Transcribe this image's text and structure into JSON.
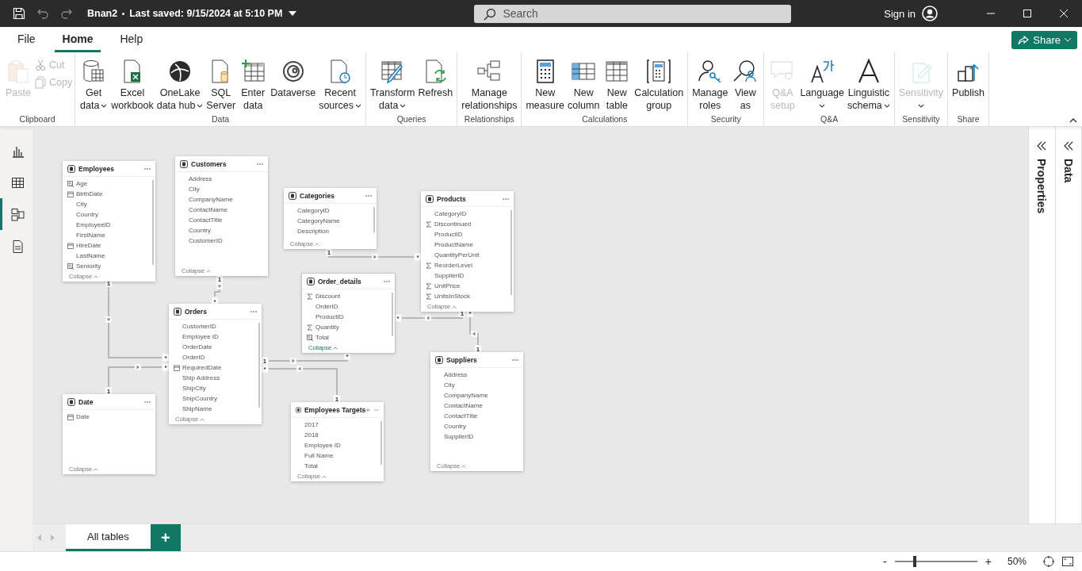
{
  "title_bar": {
    "title": "Bnan2",
    "saved": "Last saved: 9/15/2024 at 5:10 PM",
    "search": {
      "placeholder": "Search"
    },
    "sign_in": "Sign in"
  },
  "menu": [
    {
      "label": "File",
      "selected": false
    },
    {
      "label": "Home",
      "selected": true
    },
    {
      "label": "Help",
      "selected": false
    }
  ],
  "share": "Share",
  "ribbon": [
    {
      "label": "Clipboard",
      "items": [
        {
          "kind": "large",
          "lines": [
            "Paste"
          ],
          "disabled": true,
          "dropdown": false
        },
        {
          "kind": "small",
          "lines": [
            "Cut"
          ],
          "disabled": true
        },
        {
          "kind": "small",
          "lines": [
            "Copy"
          ],
          "disabled": true
        }
      ]
    },
    {
      "label": "Data",
      "items": [
        {
          "kind": "large",
          "lines": [
            "Get",
            "data"
          ],
          "disabled": false,
          "dropdown": true
        },
        {
          "kind": "large",
          "lines": [
            "Excel",
            "workbook"
          ],
          "disabled": false,
          "dropdown": false
        },
        {
          "kind": "large",
          "lines": [
            "OneLake",
            "data hub"
          ],
          "disabled": false,
          "dropdown": true
        },
        {
          "kind": "large",
          "lines": [
            "SQL",
            "Server"
          ],
          "disabled": false,
          "dropdown": false
        },
        {
          "kind": "large",
          "lines": [
            "Enter",
            "data"
          ],
          "disabled": false,
          "dropdown": false
        },
        {
          "kind": "large",
          "lines": [
            "Dataverse"
          ],
          "disabled": false,
          "dropdown": false
        },
        {
          "kind": "large",
          "lines": [
            "Recent",
            "sources"
          ],
          "disabled": false,
          "dropdown": true
        }
      ]
    },
    {
      "label": "Queries",
      "items": [
        {
          "kind": "large",
          "lines": [
            "Transform",
            "data"
          ],
          "disabled": false,
          "dropdown": true
        },
        {
          "kind": "large",
          "lines": [
            "Refresh"
          ],
          "disabled": false,
          "dropdown": false
        }
      ]
    },
    {
      "label": "Relationships",
      "items": [
        {
          "kind": "large",
          "lines": [
            "Manage",
            "relationships"
          ],
          "disabled": false,
          "dropdown": false
        }
      ]
    },
    {
      "label": "Calculations",
      "items": [
        {
          "kind": "large",
          "lines": [
            "New",
            "measure"
          ],
          "disabled": false,
          "dropdown": false
        },
        {
          "kind": "large",
          "lines": [
            "New",
            "column"
          ],
          "disabled": false,
          "dropdown": false
        },
        {
          "kind": "large",
          "lines": [
            "New",
            "table"
          ],
          "disabled": false,
          "dropdown": false
        },
        {
          "kind": "large",
          "lines": [
            "Calculation",
            "group"
          ],
          "disabled": false,
          "dropdown": false
        }
      ]
    },
    {
      "label": "Security",
      "items": [
        {
          "kind": "large",
          "lines": [
            "Manage",
            "roles"
          ],
          "disabled": false,
          "dropdown": false
        },
        {
          "kind": "large",
          "lines": [
            "View",
            "as"
          ],
          "disabled": false,
          "dropdown": false
        }
      ]
    },
    {
      "label": "Q&A",
      "items": [
        {
          "kind": "large",
          "lines": [
            "Q&A",
            "setup"
          ],
          "disabled": true,
          "dropdown": false
        },
        {
          "kind": "large",
          "lines": [
            "Language"
          ],
          "disabled": false,
          "dropdown": true
        },
        {
          "kind": "large",
          "lines": [
            "Linguistic",
            "schema"
          ],
          "disabled": false,
          "dropdown": true
        }
      ]
    },
    {
      "label": "Sensitivity",
      "items": [
        {
          "kind": "large",
          "lines": [
            "Sensitivity"
          ],
          "disabled": true,
          "dropdown": true
        }
      ]
    },
    {
      "label": "Share",
      "items": [
        {
          "kind": "large",
          "lines": [
            "Publish"
          ],
          "disabled": false,
          "dropdown": false
        }
      ]
    }
  ],
  "views": [
    {
      "selected": false
    },
    {
      "selected": false
    },
    {
      "selected": true
    },
    {
      "selected": false
    }
  ],
  "tables": [
    {
      "name": "Employees",
      "eye": false,
      "selected": false,
      "collapse": "Collapse",
      "fields": [
        {
          "name": "Age",
          "kind": "calc"
        },
        {
          "name": "BirthDate",
          "kind": "date"
        },
        {
          "name": "City",
          "kind": "plain"
        },
        {
          "name": "Country",
          "kind": "plain"
        },
        {
          "name": "EmployeeID",
          "kind": "plain"
        },
        {
          "name": "FirstName",
          "kind": "plain"
        },
        {
          "name": "HireDate",
          "kind": "date"
        },
        {
          "name": "LastName",
          "kind": "plain"
        },
        {
          "name": "Seniority",
          "kind": "calc"
        }
      ]
    },
    {
      "name": "Customers",
      "eye": false,
      "selected": false,
      "collapse": "Collapse",
      "fields": [
        {
          "name": "Address",
          "kind": "plain"
        },
        {
          "name": "City",
          "kind": "plain"
        },
        {
          "name": "CompanyName",
          "kind": "plain"
        },
        {
          "name": "ContactName",
          "kind": "plain"
        },
        {
          "name": "ContactTitle",
          "kind": "plain"
        },
        {
          "name": "Country",
          "kind": "plain"
        },
        {
          "name": "CustomerID",
          "kind": "plain"
        }
      ]
    },
    {
      "name": "Categories",
      "eye": false,
      "selected": false,
      "collapse": "Collapse",
      "fields": [
        {
          "name": "CategoryID",
          "kind": "plain"
        },
        {
          "name": "CategoryName",
          "kind": "plain"
        },
        {
          "name": "Description",
          "kind": "plain"
        }
      ]
    },
    {
      "name": "Products",
      "eye": false,
      "selected": false,
      "collapse": "Collapse",
      "fields": [
        {
          "name": "CategoryID",
          "kind": "plain"
        },
        {
          "name": "Discontinued",
          "kind": "sum"
        },
        {
          "name": "ProductID",
          "kind": "plain"
        },
        {
          "name": "ProductName",
          "kind": "plain"
        },
        {
          "name": "QuantityPerUnit",
          "kind": "plain"
        },
        {
          "name": "ReorderLevel",
          "kind": "sum"
        },
        {
          "name": "SupplierID",
          "kind": "plain"
        },
        {
          "name": "UnitPrice",
          "kind": "sum"
        },
        {
          "name": "UnitsInStock",
          "kind": "sum"
        }
      ]
    },
    {
      "name": "Order_details",
      "eye": false,
      "selected": true,
      "collapse": "Collapse",
      "fields": [
        {
          "name": "Discount",
          "kind": "sum"
        },
        {
          "name": "OrderID",
          "kind": "plain"
        },
        {
          "name": "ProductID",
          "kind": "plain"
        },
        {
          "name": "Quantity",
          "kind": "sum"
        },
        {
          "name": "Total",
          "kind": "calc"
        }
      ]
    },
    {
      "name": "Orders",
      "eye": false,
      "selected": false,
      "collapse": "Collapse",
      "fields": [
        {
          "name": "CustomerID",
          "kind": "plain"
        },
        {
          "name": "Employee ID",
          "kind": "plain"
        },
        {
          "name": "OrderDate",
          "kind": "plain"
        },
        {
          "name": "OrderID",
          "kind": "plain"
        },
        {
          "name": "RequiredDate",
          "kind": "date"
        },
        {
          "name": "Ship Address",
          "kind": "plain"
        },
        {
          "name": "ShipCity",
          "kind": "plain"
        },
        {
          "name": "ShipCountry",
          "kind": "plain"
        },
        {
          "name": "ShipName",
          "kind": "plain"
        }
      ]
    },
    {
      "name": "Date",
      "eye": false,
      "selected": false,
      "collapse": "Collapse",
      "fields": [
        {
          "name": "Date",
          "kind": "date"
        }
      ]
    },
    {
      "name": "Employees Targets",
      "eye": true,
      "selected": false,
      "collapse": "Collapse",
      "fields": [
        {
          "name": "2017",
          "kind": "plain"
        },
        {
          "name": "2018",
          "kind": "plain"
        },
        {
          "name": "Employee ID",
          "kind": "plain"
        },
        {
          "name": "Full Name",
          "kind": "plain"
        },
        {
          "name": "Total",
          "kind": "plain"
        }
      ]
    },
    {
      "name": "Suppliers",
      "eye": false,
      "selected": false,
      "collapse": "Collapse",
      "fields": [
        {
          "name": "Address",
          "kind": "plain"
        },
        {
          "name": "City",
          "kind": "plain"
        },
        {
          "name": "CompanyName",
          "kind": "plain"
        },
        {
          "name": "ContactName",
          "kind": "plain"
        },
        {
          "name": "ContactTitle",
          "kind": "plain"
        },
        {
          "name": "Country",
          "kind": "plain"
        },
        {
          "name": "SupplierID",
          "kind": "plain"
        }
      ]
    }
  ],
  "relationships": [
    {
      "from_end": "1",
      "to_end": "*"
    },
    {
      "from_end": "1",
      "to_end": "*"
    },
    {
      "from_end": "1",
      "to_end": "*"
    },
    {
      "from_end": "1",
      "to_end": "*"
    },
    {
      "from_end": "1",
      "to_end": "*"
    },
    {
      "from_end": "1",
      "to_end": "*"
    },
    {
      "from_end": "1",
      "to_end": "*"
    },
    {
      "from_end": "1",
      "to_end": "*"
    }
  ],
  "panes": [
    {
      "label": "Properties"
    },
    {
      "label": "Data"
    }
  ],
  "page_tabs": [
    {
      "label": "All tables",
      "selected": true
    }
  ],
  "add_page": "+",
  "status_bar": {
    "zoom_out": "-",
    "zoom_slider": {
      "level": 0.23
    },
    "zoom_in": "+",
    "zoom": "50%"
  }
}
